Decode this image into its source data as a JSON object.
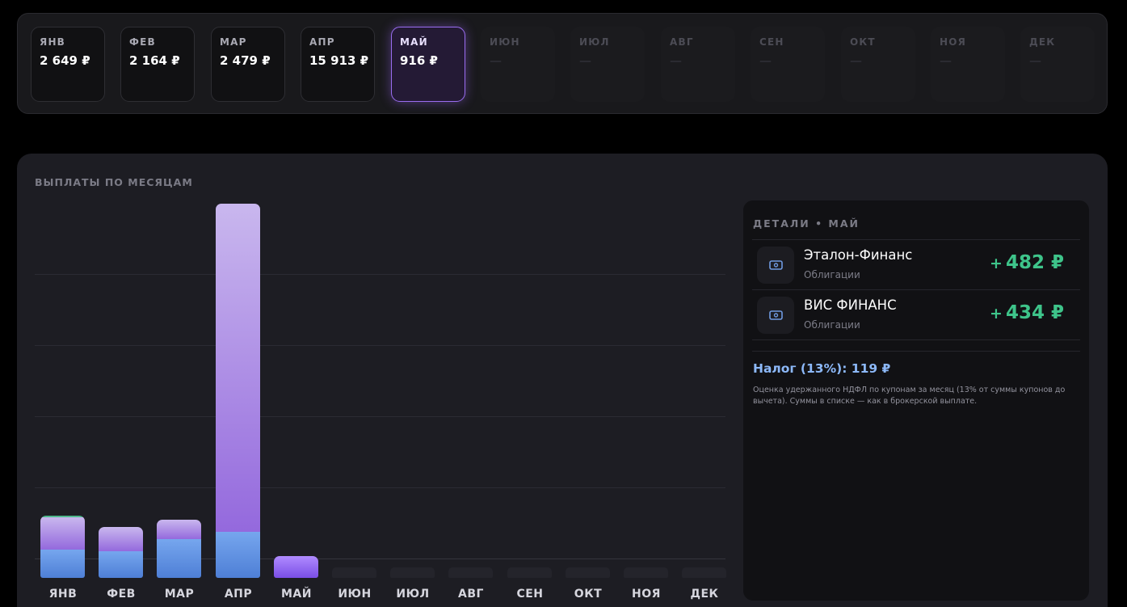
{
  "months": [
    {
      "label": "ЯНВ",
      "value": "2 649 ₽",
      "state": "filled"
    },
    {
      "label": "ФЕВ",
      "value": "2 164 ₽",
      "state": "filled"
    },
    {
      "label": "МАР",
      "value": "2 479 ₽",
      "state": "filled"
    },
    {
      "label": "АПР",
      "value": "15 913 ₽",
      "state": "filled"
    },
    {
      "label": "МАЙ",
      "value": "916 ₽",
      "state": "active"
    },
    {
      "label": "ИЮН",
      "value": "—",
      "state": "empty"
    },
    {
      "label": "ИЮЛ",
      "value": "—",
      "state": "empty"
    },
    {
      "label": "АВГ",
      "value": "—",
      "state": "empty"
    },
    {
      "label": "СЕН",
      "value": "—",
      "state": "empty"
    },
    {
      "label": "ОКТ",
      "value": "—",
      "state": "empty"
    },
    {
      "label": "НОЯ",
      "value": "—",
      "state": "empty"
    },
    {
      "label": "ДЕК",
      "value": "—",
      "state": "empty"
    }
  ],
  "chart": {
    "title": "ВЫПЛАТЫ ПО МЕСЯЦАМ"
  },
  "chart_data": {
    "type": "bar",
    "stacked": true,
    "categories": [
      "ЯНВ",
      "ФЕВ",
      "МАР",
      "АПР",
      "МАЙ",
      "ИЮН",
      "ИЮЛ",
      "АВГ",
      "СЕН",
      "ОКТ",
      "НОЯ",
      "ДЕК"
    ],
    "totals": [
      2649,
      2164,
      2479,
      15913,
      916,
      0,
      0,
      0,
      0,
      0,
      0,
      0
    ],
    "series": [
      {
        "values": [
          1200,
          1150,
          1650,
          1950,
          0,
          0,
          0,
          0,
          0,
          0,
          0,
          0
        ]
      },
      {
        "values": [
          1449,
          1014,
          829,
          13963,
          916,
          0,
          0,
          0,
          0,
          0,
          0,
          0
        ]
      }
    ],
    "ylim": [
      0,
      15913
    ],
    "grid": true,
    "highlighted_category": "МАЙ",
    "colors": {
      "lower": "#5b8de0",
      "upper": "#a57ff0",
      "active": "#8d5cf0",
      "empty": "#24242b"
    }
  },
  "details": {
    "title": "ДЕТАЛИ • МАЙ",
    "items": [
      {
        "name": "Эталон-Финанс",
        "type": "Облигации",
        "amount": "482 ₽",
        "sign": "+",
        "icon": "banknote-icon"
      },
      {
        "name": "ВИС ФИНАНС",
        "type": "Облигации",
        "amount": "434 ₽",
        "sign": "+",
        "icon": "banknote-icon"
      }
    ],
    "tax": "Налог (13%): 119 ₽",
    "note": "Оценка удержанного НДФЛ по купонам за месяц (13% от суммы купонов до вычета). Суммы в списке — как в брокерской выплате."
  },
  "colors": {
    "accent": "#9a6df0",
    "positive": "#3ec48a",
    "tax": "#8cb8f8",
    "panel": "#1d1d23"
  }
}
